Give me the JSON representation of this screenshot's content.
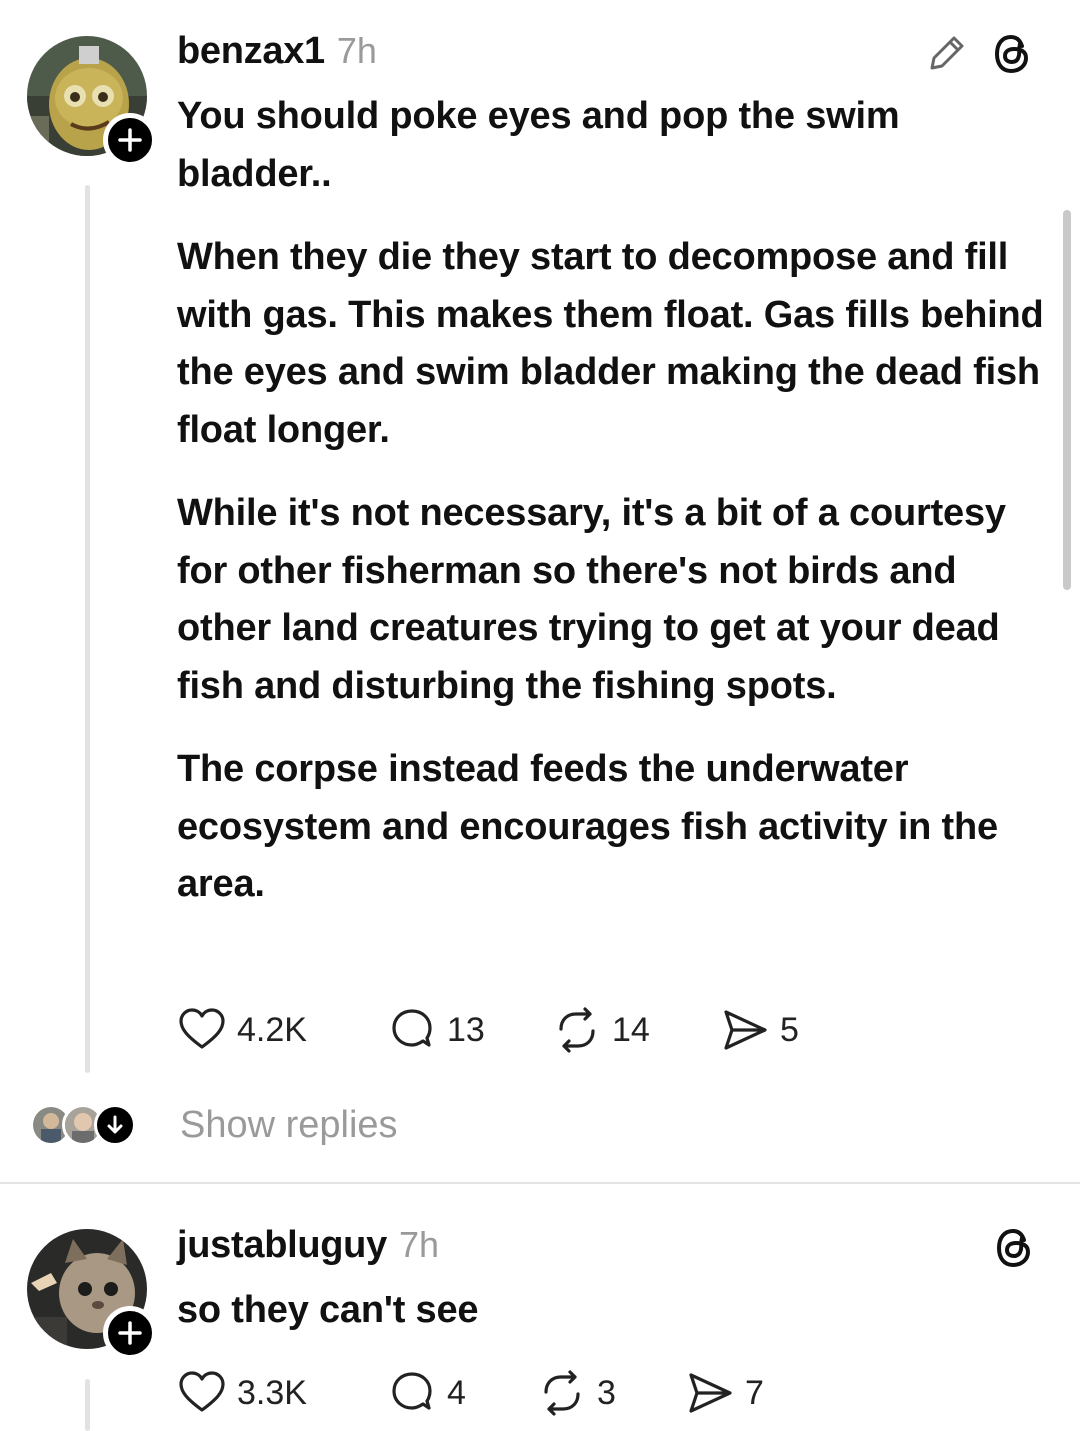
{
  "posts": [
    {
      "username": "benzax1",
      "time": "7h",
      "paragraphs": [
        "You should poke eyes and pop  the swim bladder..",
        "When they die they start to decompose and fill with gas. This makes them float. Gas fills behind the eyes and swim bladder making the dead fish float longer.",
        "While it's not necessary,  it's a bit of a courtesy for other fisherman so there's not birds and other land creatures trying to get at your dead fish and disturbing the fishing spots.",
        "The corpse instead feeds the underwater ecosystem and encourages fish activity in the area."
      ],
      "likes": "4.2K",
      "replies": "13",
      "reposts": "14",
      "shares": "5",
      "icons": [
        "edit-pencil-icon",
        "threads-logo-icon",
        "plus-icon"
      ]
    },
    {
      "username": "justabluguy",
      "time": "7h",
      "paragraphs": [
        "so they can't see"
      ],
      "likes": "3.3K",
      "replies": "4",
      "reposts": "3",
      "shares": "7",
      "icons": [
        "threads-logo-icon",
        "plus-icon"
      ]
    }
  ],
  "show_replies": {
    "label": "Show replies",
    "icon": "arrow-down-icon"
  },
  "colors": {
    "text": "#111111",
    "muted": "#9a9a9a",
    "thread_line": "#e2e2e2",
    "divider": "#e4e4e4",
    "badge": "#000000"
  }
}
